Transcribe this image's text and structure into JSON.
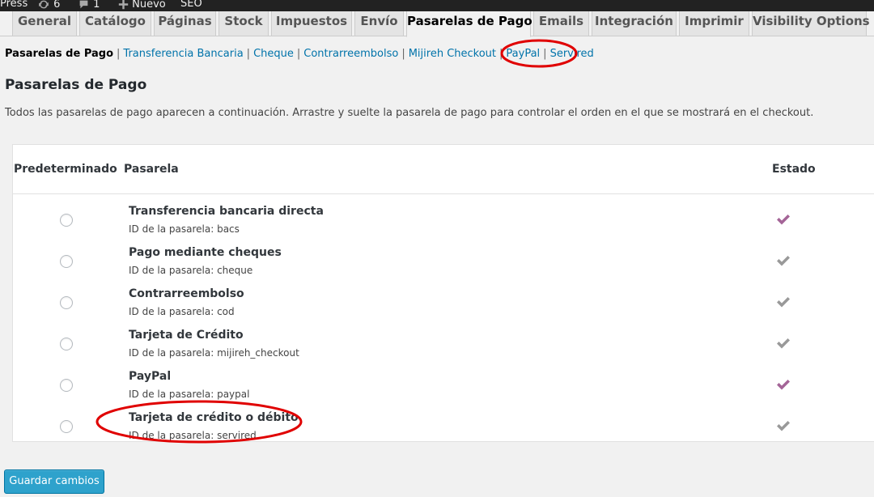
{
  "adminbar": {
    "site": "Press",
    "updates_count": "6",
    "comments_count": "1",
    "new_label": "Nuevo",
    "seo_label": "SEO"
  },
  "tabs": [
    {
      "label": "General"
    },
    {
      "label": "Catálogo"
    },
    {
      "label": "Páginas"
    },
    {
      "label": "Stock"
    },
    {
      "label": "Impuestos"
    },
    {
      "label": "Envío"
    },
    {
      "label": "Pasarelas de Pago",
      "active": true
    },
    {
      "label": "Emails"
    },
    {
      "label": "Integración"
    },
    {
      "label": "Imprimir"
    },
    {
      "label": "Visibility Options"
    }
  ],
  "subnav": [
    {
      "label": "Pasarelas de Pago",
      "current": true
    },
    {
      "label": "Transferencia Bancaria"
    },
    {
      "label": "Cheque"
    },
    {
      "label": "Contrarreembolso"
    },
    {
      "label": "Mijireh Checkout"
    },
    {
      "label": "PayPal"
    },
    {
      "label": "Servired"
    }
  ],
  "page": {
    "title": "Pasarelas de Pago",
    "description": "Todos las pasarelas de pago aparecen a continuación. Arrastre y suelte la pasarela de pago para controlar el orden en el que se mostrará en el checkout."
  },
  "table": {
    "headers": {
      "default": "Predeterminado",
      "gateway": "Pasarela",
      "status": "Estado"
    },
    "rows": [
      {
        "name": "Transferencia bancaria directa",
        "id": "ID de la pasarela: bacs",
        "enabled": true
      },
      {
        "name": "Pago mediante cheques",
        "id": "ID de la pasarela: cheque",
        "enabled": false
      },
      {
        "name": "Contrarreembolso",
        "id": "ID de la pasarela: cod",
        "enabled": false
      },
      {
        "name": "Tarjeta de Crédito",
        "id": "ID de la pasarela: mijireh_checkout",
        "enabled": false
      },
      {
        "name": "PayPal",
        "id": "ID de la pasarela: paypal",
        "enabled": true
      },
      {
        "name": "Tarjeta de crédito o débito",
        "id": "ID de la pasarela: servired",
        "enabled": false
      }
    ]
  },
  "save_button": "Guardar cambios",
  "colors": {
    "enabled_check": "#a46497",
    "disabled_check": "#999999",
    "link": "#0073aa",
    "button": "#2ea2cc",
    "annotation": "#e00000"
  },
  "icons": {
    "updates": "refresh-icon",
    "comments": "comment-bubble-icon",
    "new": "plus-icon",
    "status": "checkmark-icon"
  }
}
